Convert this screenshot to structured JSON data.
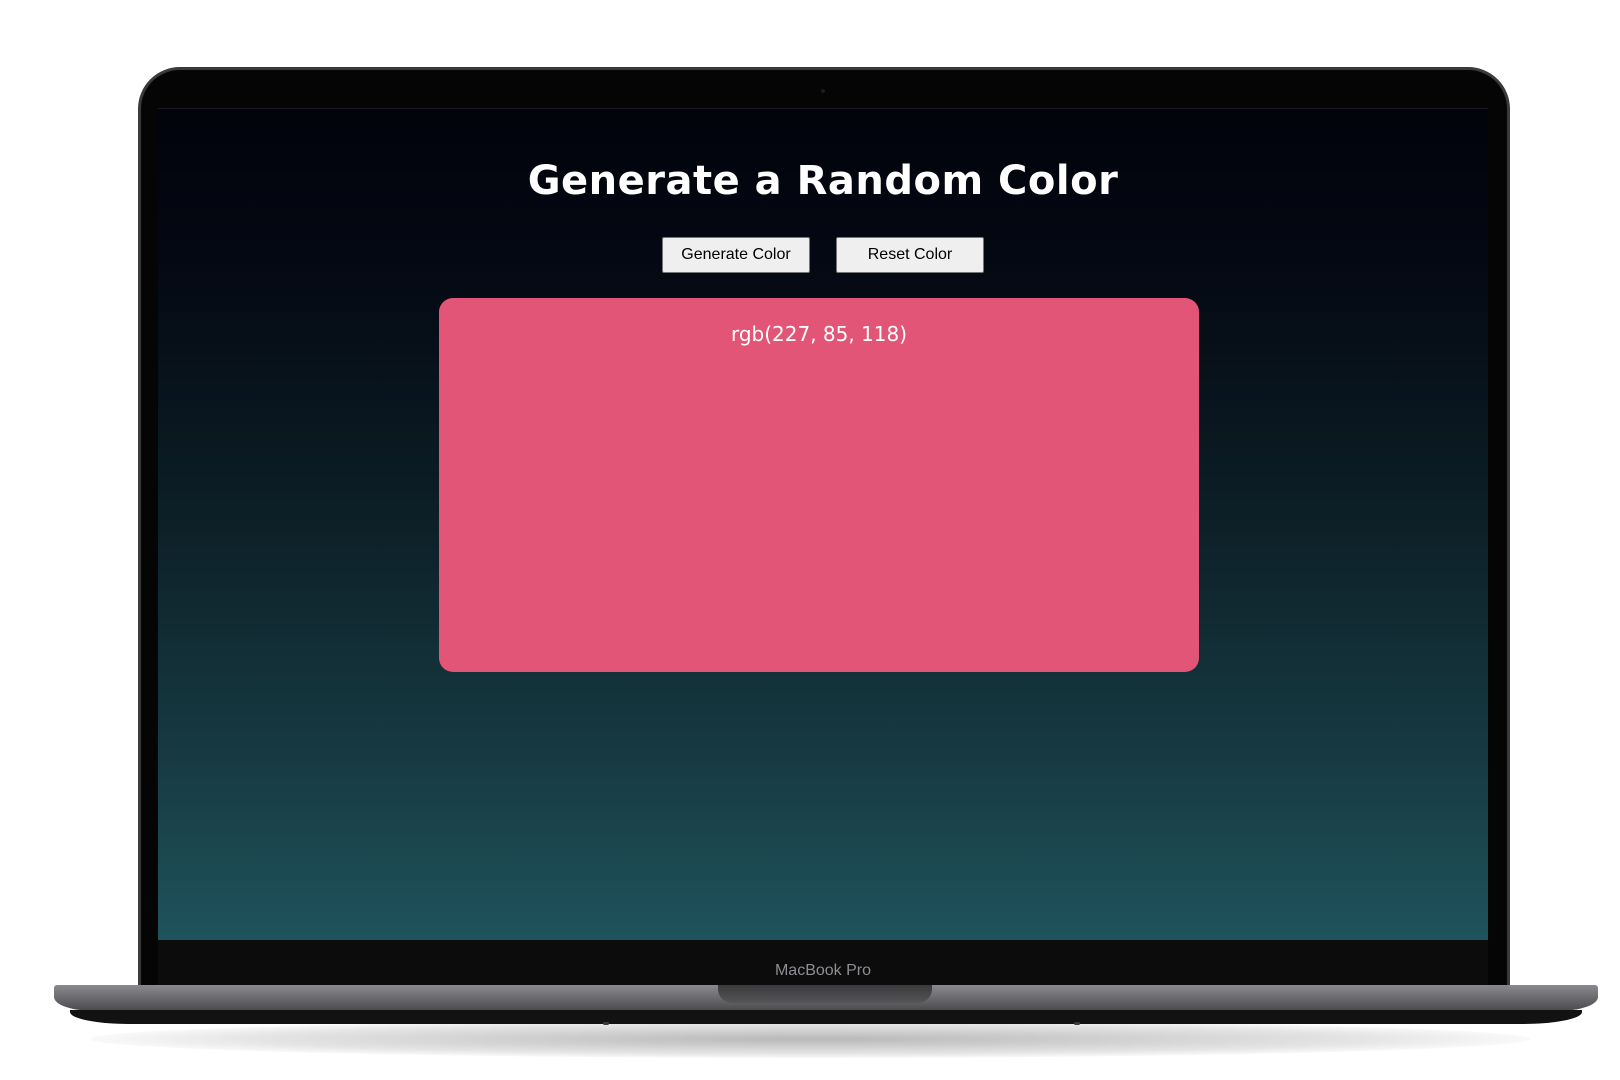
{
  "page": {
    "title": "Generate a Random Color",
    "buttons": {
      "generate_label": "Generate Color",
      "reset_label": "Reset Color"
    },
    "color_display": {
      "label": "rgb(227, 85, 118)",
      "color": "#e35576"
    }
  },
  "device": {
    "brand_label": "MacBook Pro"
  }
}
